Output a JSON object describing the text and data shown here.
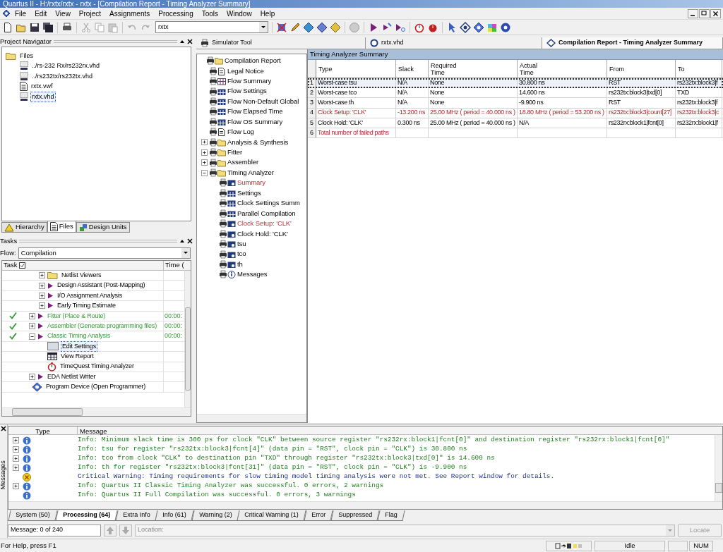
{
  "window": {
    "title": "Quartus II - H:/rxtx/rxtx - rxtx - [Compilation Report - Timing Analyzer Summary]"
  },
  "menu": [
    "File",
    "Edit",
    "View",
    "Project",
    "Assignments",
    "Processing",
    "Tools",
    "Window",
    "Help"
  ],
  "toolbar": {
    "entity": "rxtx"
  },
  "project_navigator": {
    "title": "Project Navigator",
    "tree": [
      {
        "label": "Files",
        "kind": "folder",
        "selected": false,
        "children": [
          {
            "label": "../rs-232 Rx/rs232rx.vhd",
            "kind": "vhd",
            "selected": false
          },
          {
            "label": "../rs232tx/rs232tx.vhd",
            "kind": "vhd",
            "selected": false
          },
          {
            "label": "rxtx.vwf",
            "kind": "waveform",
            "selected": false
          },
          {
            "label": "rxtx.vhd",
            "kind": "vhd",
            "selected": true
          }
        ]
      }
    ],
    "tabs": [
      {
        "label": "Hierarchy",
        "kind": "hierarchy",
        "selected": false
      },
      {
        "label": "Files",
        "kind": "files",
        "selected": true
      },
      {
        "label": "Design Units",
        "kind": "units",
        "selected": false
      }
    ]
  },
  "tasks": {
    "title": "Tasks",
    "flow_label": "Flow:",
    "flow": "Compilation",
    "columns": [
      "Task",
      "Time ("
    ],
    "tree": [
      {
        "children": [
          {
            "children": [
              {
                "label": "Netlist Viewers",
                "kind": "folder",
                "done": false,
                "expanded": false,
                "selected": false
              },
              {
                "label": "Design Assistant (Post-Mapping)",
                "kind": "run",
                "done": false,
                "expanded": false,
                "selected": false
              },
              {
                "label": "I/O Assignment Analysis",
                "kind": "run",
                "done": false,
                "expanded": false,
                "selected": false
              },
              {
                "label": "Early Timing Estimate",
                "kind": "run",
                "done": false,
                "expanded": false,
                "selected": false
              }
            ]
          },
          {
            "label": "Fitter (Place & Route)",
            "kind": "run",
            "done": true,
            "time": "00:00:",
            "expanded": false,
            "selected": false
          },
          {
            "label": "Assembler (Generate programming files)",
            "kind": "run",
            "done": true,
            "time": "00:00:",
            "expanded": false,
            "selected": false
          },
          {
            "label": "Classic Timing Analysis",
            "kind": "run",
            "done": true,
            "time": "00:00:",
            "expanded": true,
            "selected": false,
            "children": [
              {
                "label": "Edit Settings",
                "kind": "settings",
                "done": false,
                "selected": true
              },
              {
                "label": "View Report",
                "kind": "report",
                "done": false,
                "selected": false
              },
              {
                "label": "TimeQuest Timing Analyzer",
                "kind": "timequest",
                "done": false,
                "selected": false
              }
            ]
          },
          {
            "label": "EDA Netlist Writer",
            "kind": "run",
            "done": false,
            "expanded": false,
            "selected": false
          }
        ]
      },
      {
        "label": "Program Device (Open Programmer)",
        "kind": "program",
        "done": false,
        "selected": false
      }
    ]
  },
  "doc_tabs": [
    {
      "label": "Simulator Tool",
      "kind": "simulator",
      "selected": false
    },
    {
      "label": "rxtx.vhd",
      "kind": "vhd",
      "selected": false
    },
    {
      "label": "Compilation Report - Timing Analyzer Summary",
      "kind": "report",
      "selected": true
    }
  ],
  "report_tree": [
    {
      "label": "Compilation Report",
      "kind": "folder",
      "failed": false,
      "children": [
        {
          "label": "Legal Notice",
          "kind": "page",
          "failed": false
        },
        {
          "label": "Flow Summary",
          "kind": "grid",
          "failed": false
        },
        {
          "label": "Flow Settings",
          "kind": "table",
          "failed": false
        },
        {
          "label": "Flow Non-Default Global",
          "kind": "table",
          "failed": false
        },
        {
          "label": "Flow Elapsed Time",
          "kind": "table",
          "failed": false
        },
        {
          "label": "Flow OS Summary",
          "kind": "table",
          "failed": false
        },
        {
          "label": "Flow Log",
          "kind": "page",
          "failed": false
        },
        {
          "label": "Analysis & Synthesis",
          "kind": "folder",
          "failed": false,
          "expanded": false
        },
        {
          "label": "Fitter",
          "kind": "folder",
          "failed": false,
          "expanded": false
        },
        {
          "label": "Assembler",
          "kind": "folder",
          "failed": false,
          "expanded": false
        },
        {
          "label": "Timing Analyzer",
          "kind": "folder",
          "failed": false,
          "expanded": true,
          "children": [
            {
              "label": "Summary",
              "kind": "timing",
              "failed": true
            },
            {
              "label": "Settings",
              "kind": "table",
              "failed": false
            },
            {
              "label": "Clock Settings Summ",
              "kind": "table",
              "failed": false
            },
            {
              "label": "Parallel Compilation",
              "kind": "table",
              "failed": false
            },
            {
              "label": "Clock Setup: 'CLK'",
              "kind": "timing",
              "failed": true
            },
            {
              "label": "Clock Hold: 'CLK'",
              "kind": "timing",
              "failed": false
            },
            {
              "label": "tsu",
              "kind": "timing",
              "failed": false
            },
            {
              "label": "tco",
              "kind": "timing",
              "failed": false
            },
            {
              "label": "th",
              "kind": "timing",
              "failed": false
            },
            {
              "label": "Messages",
              "kind": "info",
              "failed": false
            }
          ]
        }
      ]
    }
  ],
  "summary_table": {
    "title": "Timing Analyzer Summary",
    "columns": [
      "Type",
      "Slack",
      "Required Time",
      "Actual Time",
      "From",
      "To"
    ],
    "rows": [
      {
        "index": "1",
        "failed": false,
        "selected": true,
        "cells": [
          "Worst-case tsu",
          "N/A",
          "None",
          "30.800 ns",
          "RST",
          "rs232tx:block3|f"
        ]
      },
      {
        "index": "2",
        "failed": false,
        "selected": false,
        "cells": [
          "Worst-case tco",
          "N/A",
          "None",
          "14.600 ns",
          "rs232tx:block3|txd[0]",
          "TXD"
        ]
      },
      {
        "index": "3",
        "failed": false,
        "selected": false,
        "cells": [
          "Worst-case th",
          "N/A",
          "None",
          "-9.900 ns",
          "RST",
          "rs232tx:block3|f"
        ]
      },
      {
        "index": "4",
        "failed": true,
        "selected": false,
        "cells": [
          "Clock Setup: 'CLK'",
          "-13.200 ns",
          "25.00 MHz ( period = 40.000 ns )",
          "18.80 MHz ( period = 53.200 ns )",
          "rs232tx:block3|count[27]",
          "rs232tx:block3|c"
        ]
      },
      {
        "index": "5",
        "failed": false,
        "selected": false,
        "cells": [
          "Clock Hold: 'CLK'",
          "0.300 ns",
          "25.00 MHz ( period = 40.000 ns )",
          "N/A",
          "rs232rx:block1|fcnt[0]",
          "rs232rx:block1|f"
        ]
      },
      {
        "index": "6",
        "failed": true,
        "selected": false,
        "cells": [
          "Total number of failed paths"
        ]
      }
    ]
  },
  "messages": {
    "columns": [
      "Type",
      "Message"
    ],
    "rows": [
      {
        "kind": "info",
        "expandable": true,
        "text": "Info: Minimum slack time is 300 ps for clock \"CLK\" between source register \"rs232rx:block1|fcnt[0]\" and destination register \"rs232rx:block1|fcnt[0]\""
      },
      {
        "kind": "info",
        "expandable": true,
        "text": "Info: tsu for register \"rs232tx:block3|fcnt[4]\" (data pin = \"RST\", clock pin = \"CLK\") is 30.800 ns"
      },
      {
        "kind": "info",
        "expandable": true,
        "text": "Info: tco from clock \"CLK\" to destination pin \"TXD\" through register \"rs232tx:block3|txd[0]\" is 14.600 ns"
      },
      {
        "kind": "info",
        "expandable": true,
        "text": "Info: th for register \"rs232tx:block3|fcnt[31]\" (data pin = \"RST\", clock pin = \"CLK\") is -9.900 ns"
      },
      {
        "kind": "critical",
        "expandable": false,
        "text": "Critical Warning: Timing requirements for slow timing model timing analysis were not met. See Report window for details."
      },
      {
        "kind": "info",
        "expandable": true,
        "text": "Info: Quartus II Classic Timing Analyzer was successful. 0 errors, 2 warnings"
      },
      {
        "kind": "info",
        "expandable": false,
        "text": "Info: Quartus II Full Compilation was successful. 0 errors, 3 warnings"
      }
    ],
    "side_label": "Messages",
    "tabs": [
      {
        "label": "System (50)",
        "selected": false
      },
      {
        "label": "Processing (64)",
        "selected": true
      },
      {
        "label": "Extra Info",
        "selected": false
      },
      {
        "label": "Info (61)",
        "selected": false
      },
      {
        "label": "Warning (2)",
        "selected": false
      },
      {
        "label": "Critical Warning (1)",
        "selected": false
      },
      {
        "label": "Error",
        "selected": false
      },
      {
        "label": "Suppressed",
        "selected": false
      },
      {
        "label": "Flag",
        "selected": false
      }
    ],
    "count": "Message: 0 of 240",
    "location_label": "Location:",
    "locate_button": {
      "label": "Locate",
      "disabled": true
    }
  },
  "status_bar": {
    "help": "For Help, press F1",
    "state": "Idle",
    "num": "NUM"
  }
}
